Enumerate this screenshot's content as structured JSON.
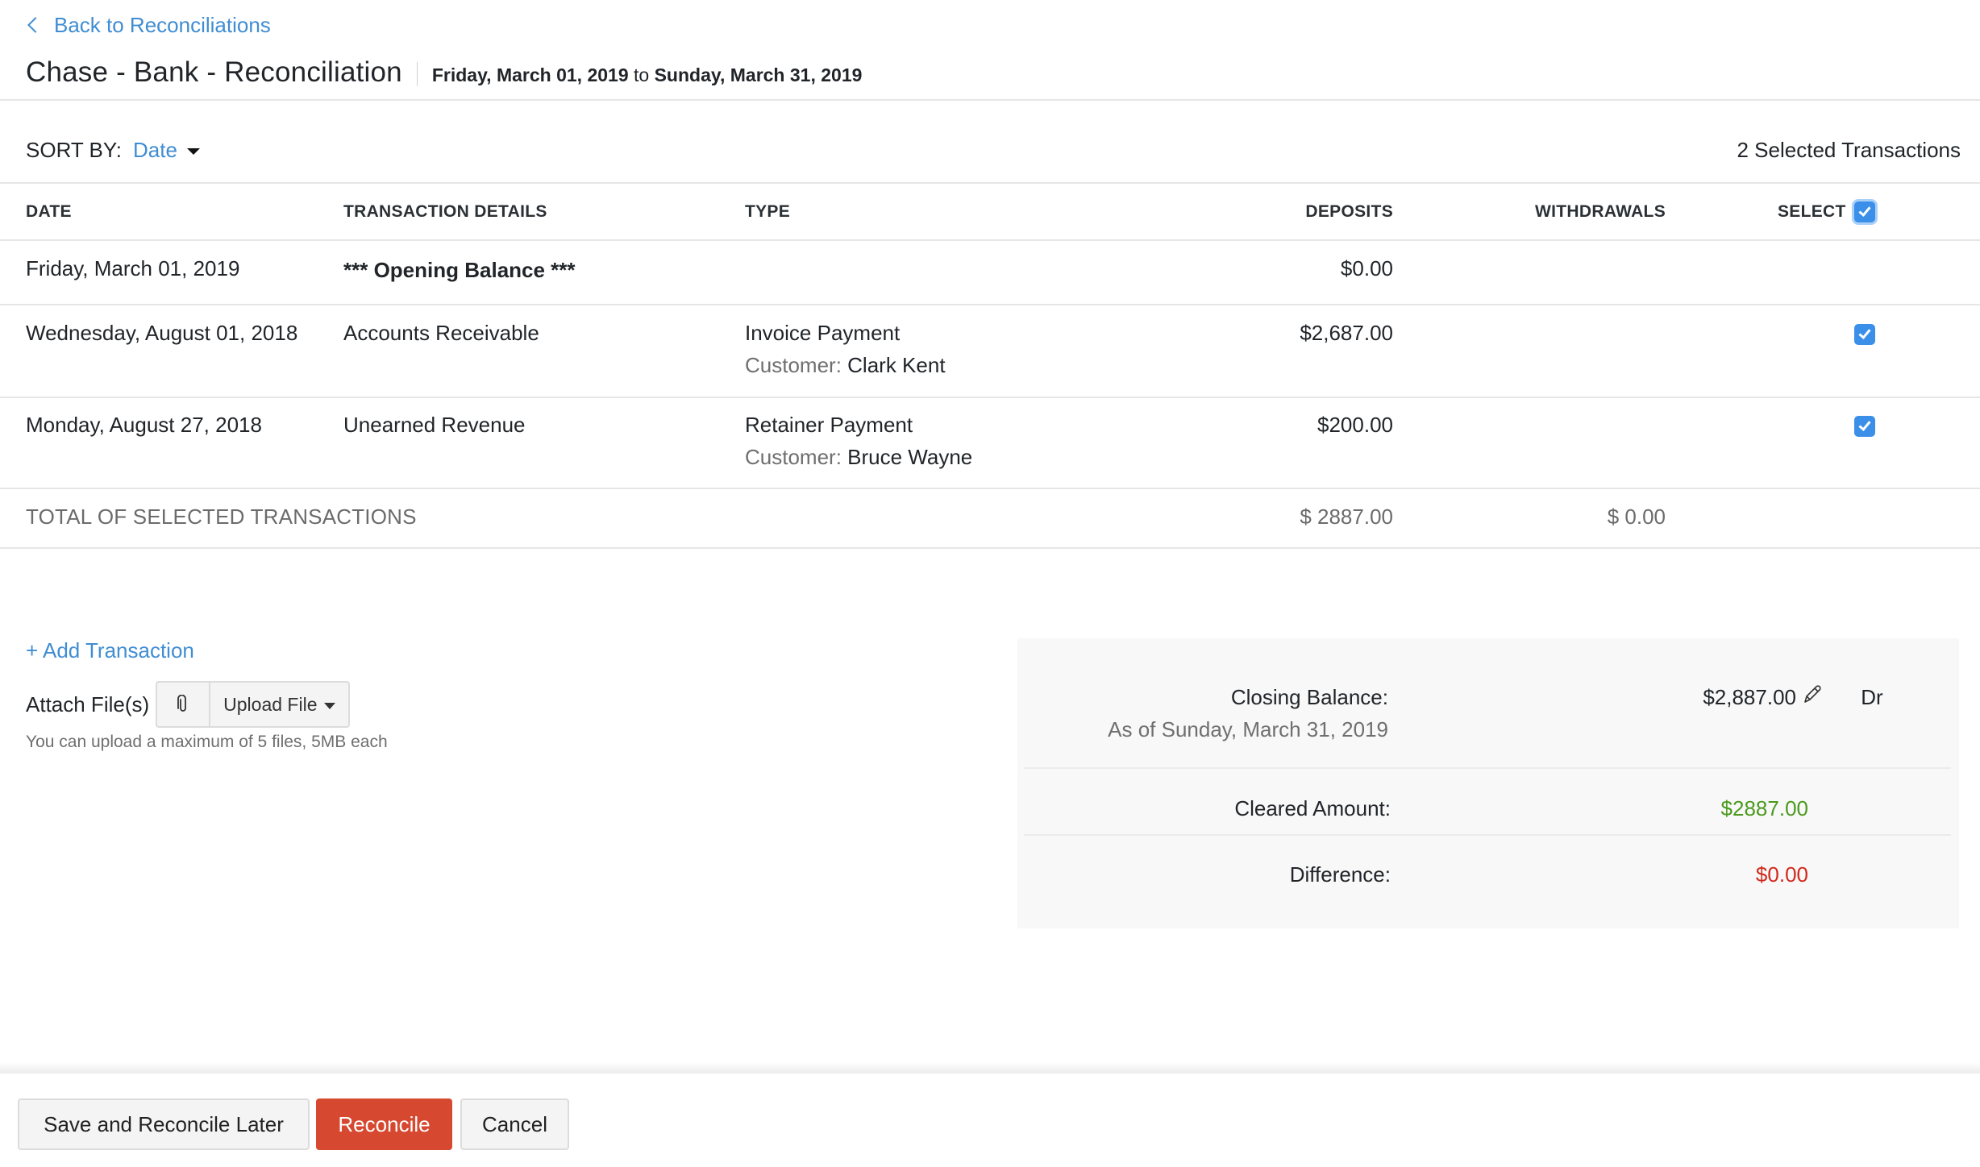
{
  "header": {
    "back_link": "Back to Reconciliations",
    "title": "Chase - Bank - Reconciliation",
    "date_from": "Friday, March 01, 2019",
    "date_to_word": "to",
    "date_to": "Sunday, March 31, 2019"
  },
  "sort": {
    "label": "SORT BY:",
    "value": "Date",
    "selected_count_text": "2 Selected Transactions"
  },
  "table": {
    "columns": [
      "DATE",
      "TRANSACTION DETAILS",
      "TYPE",
      "DEPOSITS",
      "WITHDRAWALS",
      "SELECT"
    ],
    "select_all_checked": true,
    "rows": [
      {
        "date": "Friday, March 01, 2019",
        "details": "*** Opening Balance ***",
        "type": "",
        "customer_label": "",
        "customer": "",
        "deposit": "$0.00",
        "withdrawal": "",
        "selectable": false
      },
      {
        "date": "Wednesday, August 01, 2018",
        "details": "Accounts Receivable",
        "type": "Invoice Payment",
        "customer_label": "Customer:",
        "customer": "Clark Kent",
        "deposit": "$2,687.00",
        "withdrawal": "",
        "checked": true
      },
      {
        "date": "Monday, August 27, 2018",
        "details": "Unearned Revenue",
        "type": "Retainer Payment",
        "customer_label": "Customer:",
        "customer": "Bruce Wayne",
        "deposit": "$200.00",
        "withdrawal": "",
        "checked": true
      }
    ],
    "total": {
      "label": "TOTAL OF SELECTED TRANSACTIONS",
      "deposits": "$ 2887.00",
      "withdrawals": "$ 0.00"
    }
  },
  "attachments": {
    "add_transaction": "+ Add Transaction",
    "attach_label": "Attach File(s)",
    "upload_button": "Upload File",
    "help_text": "You can upload a maximum of 5 files, 5MB each"
  },
  "summary": {
    "closing_balance_label": "Closing Balance:",
    "closing_balance_date": "As of Sunday, March 31, 2019",
    "closing_balance_value": "$2,887.00",
    "closing_balance_type": "Dr",
    "cleared_label": "Cleared Amount:",
    "cleared_value": "$2887.00",
    "difference_label": "Difference:",
    "difference_value": "$0.00",
    "colors": {
      "cleared": "#4a9a1c",
      "difference": "#d1281b"
    }
  },
  "footer": {
    "save_later": "Save and Reconcile Later",
    "reconcile": "Reconcile",
    "cancel": "Cancel"
  },
  "theme": {
    "link_color": "#408dd2",
    "primary_button": "#d64930",
    "checkbox": "#3b8fe8"
  }
}
